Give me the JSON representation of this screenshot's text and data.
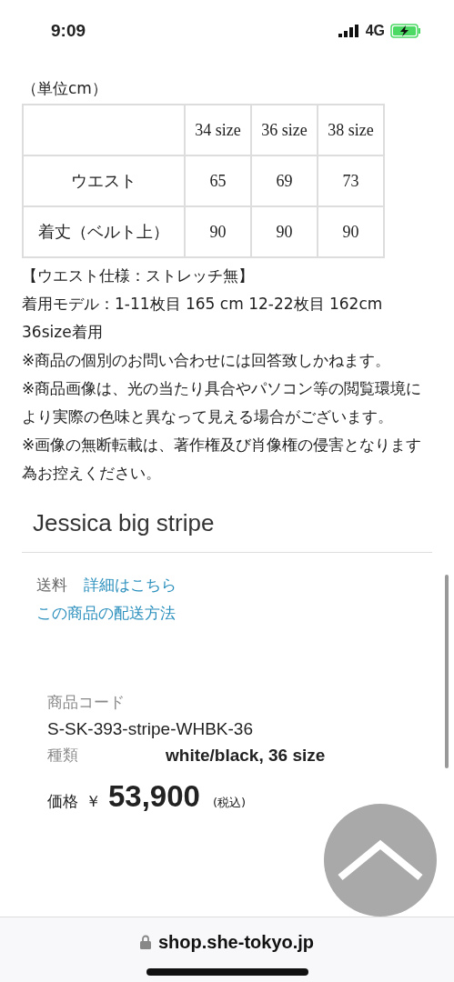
{
  "status_bar": {
    "time": "9:09",
    "network": "4G"
  },
  "size_table": {
    "unit": "（単位cm）",
    "columns": [
      "34 size",
      "36 size",
      "38 size"
    ],
    "rows": [
      {
        "label": "ウエスト",
        "values": [
          "65",
          "69",
          "73"
        ]
      },
      {
        "label": "着丈（ベルト上）",
        "values": [
          "90",
          "90",
          "90"
        ]
      }
    ]
  },
  "notes": [
    "【ウエスト仕様：ストレッチ無】",
    "着用モデル：1-11枚目 165 cm 12-22枚目 162cm 36size着用",
    "※商品の個別のお問い合わせには回答致しかねます。",
    "※商品画像は、光の当たり具合やパソコン等の閲覧環境により実際の色味と異なって見える場合がございます。",
    "※画像の無断転載は、著作権及び肖像権の侵害となります為お控えください。"
  ],
  "product": {
    "title": "Jessica big stripe",
    "shipping_label": "送料",
    "shipping_link": "詳細はこちら",
    "delivery_link": "この商品の配送方法",
    "code_label": "商品コード",
    "code": "S-SK-393-stripe-WHBK-36",
    "variant_label": "種類",
    "variant": "white/black, 36 size",
    "price_label": "価格",
    "currency": "￥",
    "price": "53,900",
    "tax_note": "(税込)"
  },
  "address_bar": {
    "url": "shop.she-tokyo.jp"
  }
}
